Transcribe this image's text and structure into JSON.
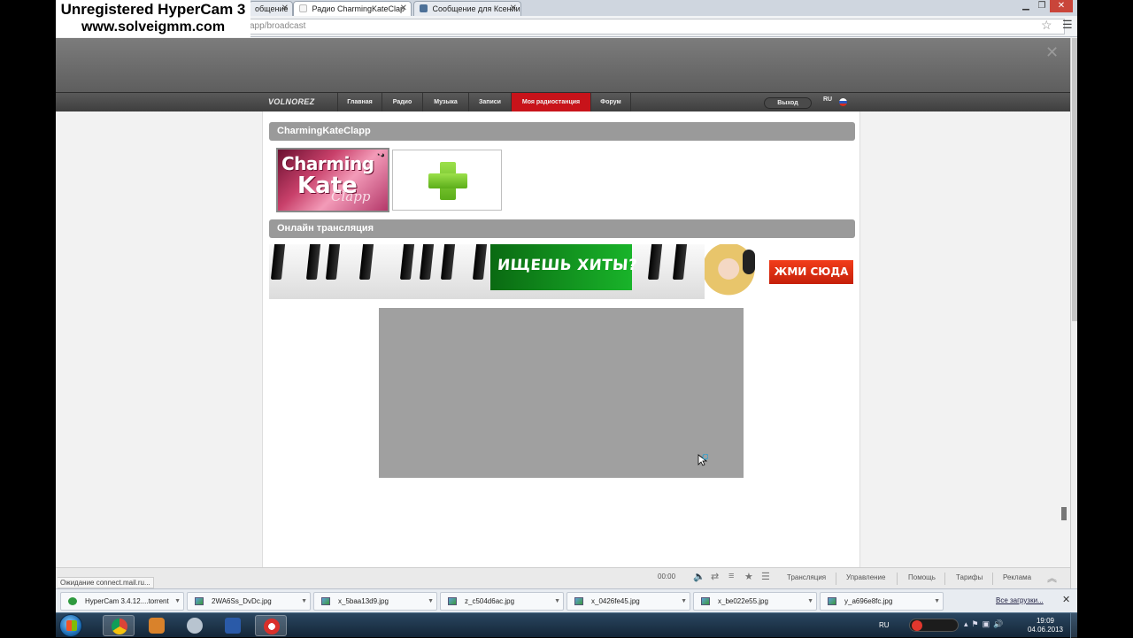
{
  "watermark": {
    "line1": "Unregistered HyperCam 3",
    "line2": "www.solveigmm.com"
  },
  "browser": {
    "tabs": [
      {
        "label": "общение",
        "active": false
      },
      {
        "label": "Радио CharmingKateClap",
        "active": true
      },
      {
        "label": "Сообщение для Ксении",
        "active": false
      }
    ],
    "address": "app/broadcast"
  },
  "site": {
    "logo": "VOLNOREZ",
    "nav": [
      {
        "label": "Главная",
        "active": false
      },
      {
        "label": "Радио",
        "active": false
      },
      {
        "label": "Музыка",
        "active": false
      },
      {
        "label": "Записи",
        "active": false
      },
      {
        "label": "Моя радиостанция",
        "active": true
      },
      {
        "label": "Форум",
        "active": false
      }
    ],
    "logout": "Выход",
    "lang": "RU"
  },
  "station": {
    "name": "CharmingKateClapp",
    "avatar_text": {
      "line1": "Charming",
      "line2": "Kate",
      "line3": "Clapp"
    },
    "section_broadcast": "Онлайн трансляция"
  },
  "ad": {
    "text": "ИЩЕШЬ ХИТЫ?",
    "button": "ЖМИ СЮДА"
  },
  "pagebar": {
    "status": "Ожидание connect.mail.ru...",
    "time": "00:00",
    "links": [
      "Трансляция",
      "Управление",
      "Помощь",
      "Тарифы",
      "Реклама"
    ]
  },
  "downloads": {
    "items": [
      "HyperCam 3.4.12....torrent",
      "2WA6Ss_DvDc.jpg",
      "x_5baa13d9.jpg",
      "z_c504d6ac.jpg",
      "x_0426fe45.jpg",
      "x_be022e55.jpg",
      "y_a696e8fc.jpg"
    ],
    "show_all": "Все загрузки..."
  },
  "taskbar": {
    "lang": "RU",
    "time": "19:09",
    "date": "04.06.2013"
  },
  "colors": {
    "nav_active": "#c8131a",
    "section_header": "#9a9a9a",
    "player_bg": "#a0a0a0",
    "ad_green": "#19b42a",
    "ad_red": "#e2301a"
  }
}
